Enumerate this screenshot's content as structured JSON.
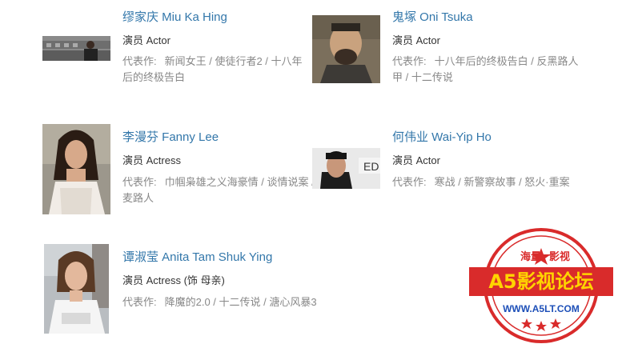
{
  "celebrities": [
    {
      "name": "缪家庆 Miu Ka Hing",
      "role": "演员 Actor",
      "works_label": "代表作:",
      "works": "新闻女王 / 使徒行者2 / 十八年后的终极告白"
    },
    {
      "name": "鬼塚 Oni Tsuka",
      "role": "演员 Actor",
      "works_label": "代表作:",
      "works": "十八年后的终极告白 / 反黑路人甲 / 十二传说"
    },
    {
      "name": "李漫芬 Fanny Lee",
      "role": "演员 Actress",
      "works_label": "代表作:",
      "works": "巾帼枭雄之义海豪情 / 谈情说案 / 麦路人"
    },
    {
      "name": "何伟业 Wai-Yip Ho",
      "role": "演员 Actor",
      "works_label": "代表作:",
      "works": "寒战 / 新警察故事 / 怒火·重案"
    },
    {
      "name": "谭淑莹 Anita Tam Shuk Ying",
      "role": "演员 Actress (饰 母亲)",
      "works_label": "代表作:",
      "works": "降魔的2.0 / 十二传说 / 溏心风暴3"
    }
  ],
  "watermark": {
    "top_text": "海量",
    "top_text2": "影视",
    "title": "A5影视论坛",
    "url": "WWW.A5LT.COM"
  },
  "colors": {
    "link": "#3377aa",
    "muted": "#888888",
    "stamp_red": "#d92b2b",
    "stamp_yellow": "#ffd400"
  }
}
